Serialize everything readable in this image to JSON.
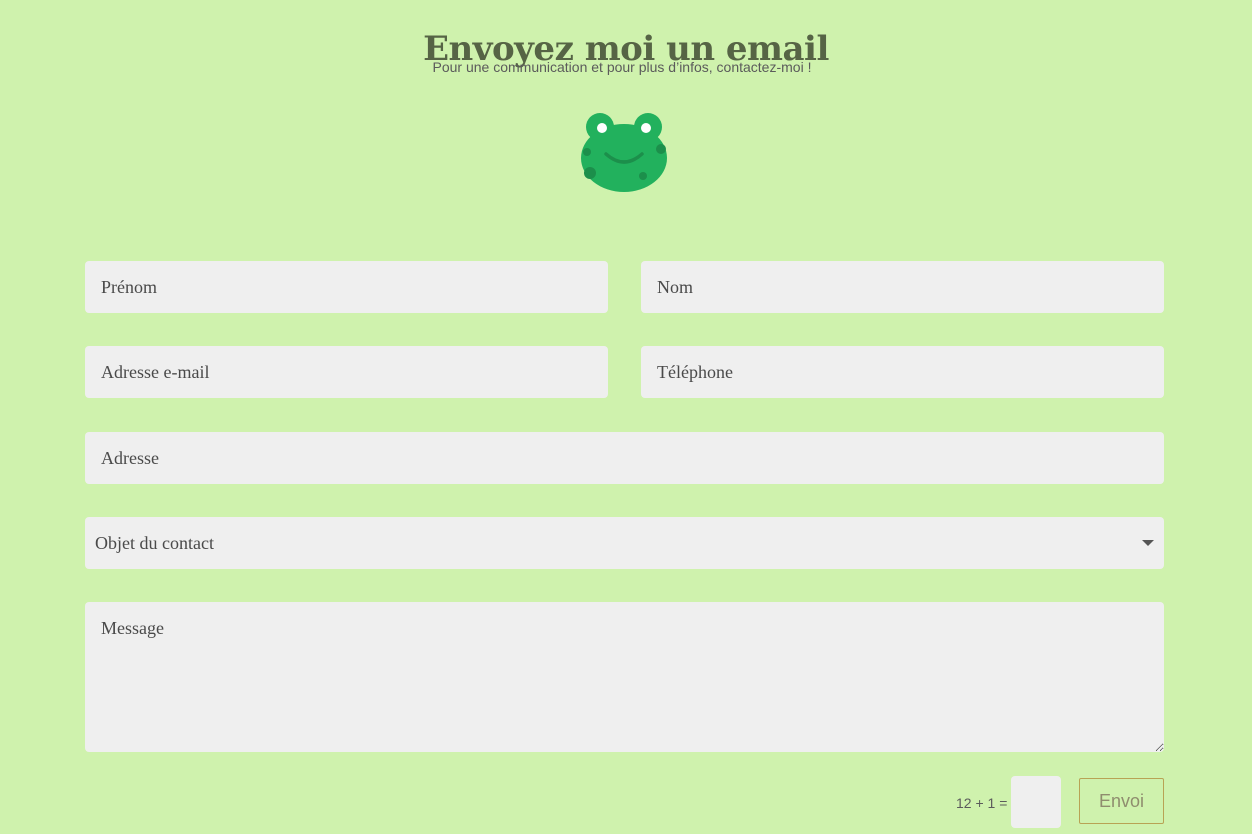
{
  "header": {
    "title": "Envoyez moi un email",
    "subtitle": "Pour une communication et pour plus d’infos, contactez-moi !",
    "logo_icon": "frog-face-icon"
  },
  "form": {
    "prenom_placeholder": "Prénom",
    "nom_placeholder": "Nom",
    "email_placeholder": "Adresse e-mail",
    "telephone_placeholder": "Téléphone",
    "adresse_placeholder": "Adresse",
    "objet_selected": "Objet du contact",
    "message_placeholder": "Message",
    "captcha_label": "12 + 1 =",
    "captcha_value": "",
    "submit_label": "Envoi"
  },
  "colors": {
    "background": "#cff2ad",
    "field_background": "#efefef",
    "title": "#566445",
    "button_border": "#b8a355",
    "frog_green": "#22b15d"
  }
}
